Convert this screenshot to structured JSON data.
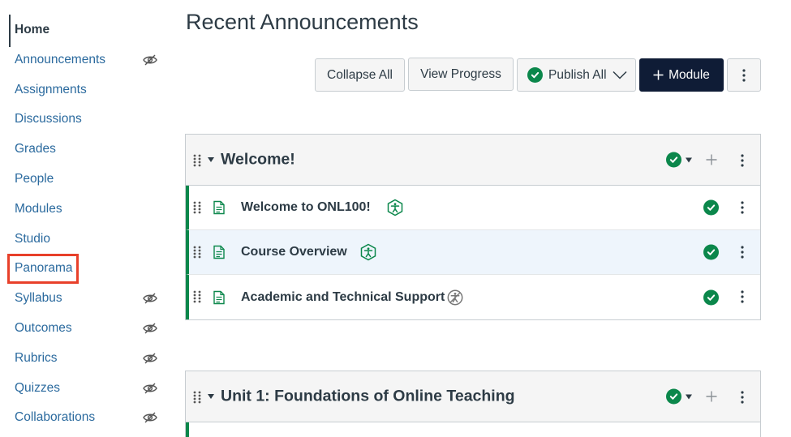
{
  "sidebar": {
    "items": [
      {
        "label": "Home",
        "hidden": false,
        "active": true
      },
      {
        "label": "Announcements",
        "hidden": true
      },
      {
        "label": "Assignments",
        "hidden": false
      },
      {
        "label": "Discussions",
        "hidden": false
      },
      {
        "label": "Grades",
        "hidden": false
      },
      {
        "label": "People",
        "hidden": false
      },
      {
        "label": "Modules",
        "hidden": false
      },
      {
        "label": "Studio",
        "hidden": false
      },
      {
        "label": "Panorama",
        "hidden": false,
        "highlighted": true
      },
      {
        "label": "Syllabus",
        "hidden": true
      },
      {
        "label": "Outcomes",
        "hidden": true
      },
      {
        "label": "Rubrics",
        "hidden": true
      },
      {
        "label": "Quizzes",
        "hidden": true
      },
      {
        "label": "Collaborations",
        "hidden": true
      }
    ]
  },
  "page": {
    "title": "Recent Announcements"
  },
  "toolbar": {
    "collapse_all": "Collapse All",
    "view_progress": "View Progress",
    "publish_all": "Publish All",
    "add_module": "Module"
  },
  "modules": [
    {
      "title": "Welcome!",
      "published": true,
      "items": [
        {
          "title": "Welcome to ONL100!",
          "published": true,
          "accessibility": "passed"
        },
        {
          "title": "Course Overview",
          "published": true,
          "accessibility": "passed"
        },
        {
          "title": "Academic and Technical Support",
          "published": true,
          "accessibility": "unchecked"
        }
      ]
    },
    {
      "title": "Unit 1: Foundations of Online Teaching",
      "published": true,
      "items": []
    }
  ],
  "colors": {
    "link": "#2b6a9e",
    "published_green": "#0b874b",
    "module_button_bg": "#0f1c36",
    "highlight_red": "#e8402a"
  }
}
